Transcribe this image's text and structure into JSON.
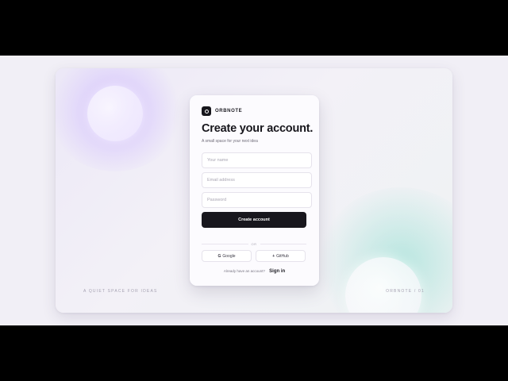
{
  "brand": {
    "name": "ORBNOTE"
  },
  "form": {
    "title": "Create your account.",
    "subtitle": "A small space for your next idea",
    "name_placeholder": "Your name",
    "email_placeholder": "Email address",
    "password_placeholder": "Password",
    "submit_label": "Create account",
    "divider_label": "OR"
  },
  "social": {
    "google_icon": "G",
    "google_label": "Google",
    "github_icon": "+",
    "github_label": "GitHub"
  },
  "signin": {
    "prompt": "Already have an account?",
    "link_label": "Sign in"
  },
  "footer": {
    "left": "A QUIET SPACE FOR IDEAS",
    "right": "ORBNOTE / 01"
  },
  "colors": {
    "primary": "#18171d",
    "accent_purple": "#c4aaff",
    "accent_teal": "#a0e1d7",
    "background": "#f1eff6"
  }
}
